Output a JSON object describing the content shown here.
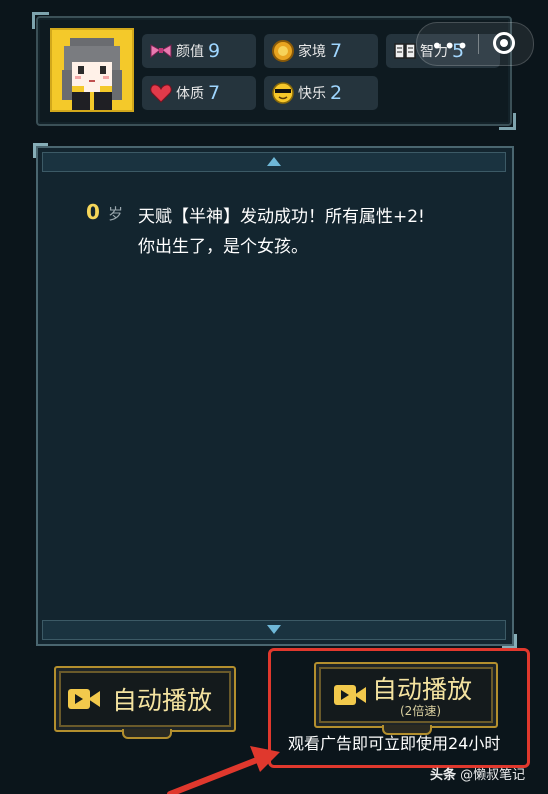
{
  "stats": {
    "beauty": {
      "label": "颜值",
      "value": "9",
      "icon": "bow-icon"
    },
    "family": {
      "label": "家境",
      "value": "7",
      "icon": "coin-icon"
    },
    "intelligence": {
      "label": "智力",
      "value": "5",
      "icon": "book-icon"
    },
    "physique": {
      "label": "体质",
      "value": "7",
      "icon": "heart-icon"
    },
    "happiness": {
      "label": "快乐",
      "value": "2",
      "icon": "sunglasses-face-icon"
    }
  },
  "capsule": {
    "dots": "•••"
  },
  "log": {
    "age": "0",
    "age_unit": "岁",
    "line1": "天赋【半神】发动成功！所有属性+2!",
    "line2": "你出生了，是个女孩。"
  },
  "buttons": {
    "auto_play": "自动播放",
    "auto_play_2x": "自动播放",
    "auto_play_2x_sub": "(2倍速)"
  },
  "ad_note": "观看广告即可立即使用24小时",
  "watermark": {
    "platform": "头条",
    "account": "@懒叔笔记"
  },
  "colors": {
    "highlight": "#e0382d",
    "gold_border": "#b38f2e",
    "stat_value": "#9fd6ff",
    "age": "#f6d75a"
  }
}
